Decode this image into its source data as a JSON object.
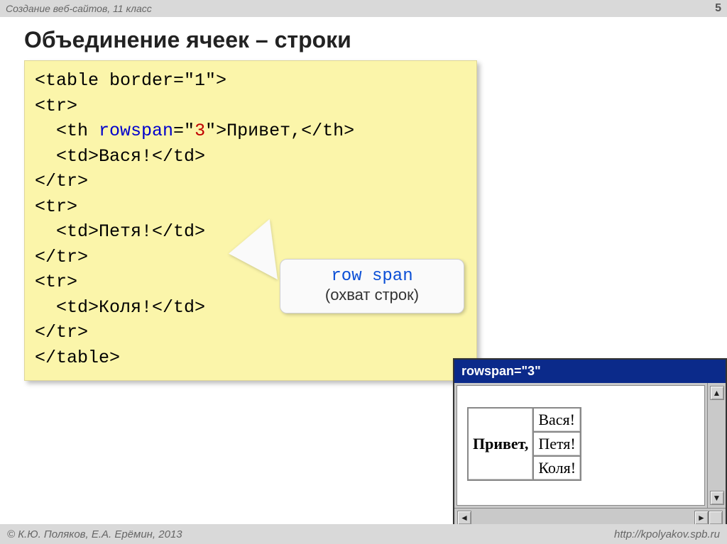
{
  "header": {
    "course": "Создание веб-сайтов, 11 класс",
    "page_number": "5"
  },
  "title": "Объединение ячеек – строки",
  "code": {
    "line1_open": "<table border=\"1\">",
    "tr": "<tr>",
    "th_open": "  <th ",
    "rowspan_attr": "rowspan",
    "eq": "=\"",
    "rowspan_val": "3",
    "th_close": "\">Привет,</th>",
    "td1": "  <td>Вася!</td>",
    "ctr": "</tr>",
    "td2": "  <td>Петя!</td>",
    "td3": "  <td>Коля!</td>",
    "ctable": "</table>"
  },
  "callout": {
    "kw": "row span",
    "sub": "(охват строк)"
  },
  "result": {
    "title": "rowspan=\"3\"",
    "header_cell": "Привет,",
    "rows": [
      "Вася!",
      "Петя!",
      "Коля!"
    ]
  },
  "footer": {
    "left": "© К.Ю. Поляков, Е.А. Ерёмин, 2013",
    "right": "http://kpolyakov.spb.ru"
  }
}
